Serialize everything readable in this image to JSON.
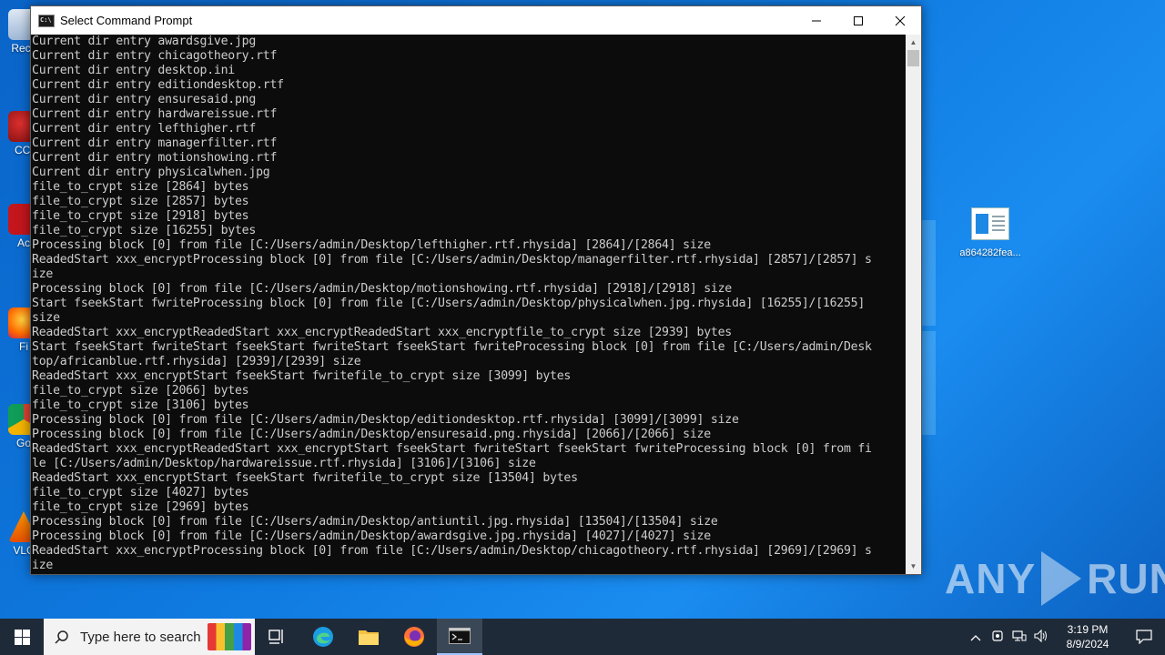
{
  "window": {
    "title": "Select Command Prompt",
    "app_icon": "C:\\",
    "minimize_icon": "minimize-icon",
    "maximize_icon": "maximize-icon",
    "close_icon": "close-icon"
  },
  "console_lines": [
    "Current dir entry awardsgive.jpg",
    "Current dir entry chicagotheory.rtf",
    "Current dir entry desktop.ini",
    "Current dir entry editiondesktop.rtf",
    "Current dir entry ensuresaid.png",
    "Current dir entry hardwareissue.rtf",
    "Current dir entry lefthigher.rtf",
    "Current dir entry managerfilter.rtf",
    "Current dir entry motionshowing.rtf",
    "Current dir entry physicalwhen.jpg",
    "file_to_crypt size [2864] bytes",
    "file_to_crypt size [2857] bytes",
    "file_to_crypt size [2918] bytes",
    "file_to_crypt size [16255] bytes",
    "Processing block [0] from file [C:/Users/admin/Desktop/lefthigher.rtf.rhysida] [2864]/[2864] size",
    "ReadedStart xxx_encryptProcessing block [0] from file [C:/Users/admin/Desktop/managerfilter.rtf.rhysida] [2857]/[2857] s",
    "ize",
    "Processing block [0] from file [C:/Users/admin/Desktop/motionshowing.rtf.rhysida] [2918]/[2918] size",
    "Start fseekStart fwriteProcessing block [0] from file [C:/Users/admin/Desktop/physicalwhen.jpg.rhysida] [16255]/[16255]",
    "size",
    "ReadedStart xxx_encryptReadedStart xxx_encryptReadedStart xxx_encryptfile_to_crypt size [2939] bytes",
    "Start fseekStart fwriteStart fseekStart fwriteStart fseekStart fwriteProcessing block [0] from file [C:/Users/admin/Desk",
    "top/africanblue.rtf.rhysida] [2939]/[2939] size",
    "ReadedStart xxx_encryptStart fseekStart fwritefile_to_crypt size [3099] bytes",
    "file_to_crypt size [2066] bytes",
    "file_to_crypt size [3106] bytes",
    "Processing block [0] from file [C:/Users/admin/Desktop/editiondesktop.rtf.rhysida] [3099]/[3099] size",
    "Processing block [0] from file [C:/Users/admin/Desktop/ensuresaid.png.rhysida] [2066]/[2066] size",
    "ReadedStart xxx_encryptReadedStart xxx_encryptStart fseekStart fwriteStart fseekStart fwriteProcessing block [0] from fi",
    "le [C:/Users/admin/Desktop/hardwareissue.rtf.rhysida] [3106]/[3106] size",
    "ReadedStart xxx_encryptStart fseekStart fwritefile_to_crypt size [13504] bytes",
    "file_to_crypt size [4027] bytes",
    "file_to_crypt size [2969] bytes",
    "Processing block [0] from file [C:/Users/admin/Desktop/antiuntil.jpg.rhysida] [13504]/[13504] size",
    "Processing block [0] from file [C:/Users/admin/Desktop/awardsgive.jpg.rhysida] [4027]/[4027] size",
    "ReadedStart xxx_encryptProcessing block [0] from file [C:/Users/admin/Desktop/chicagotheory.rtf.rhysida] [2969]/[2969] s",
    "ize"
  ],
  "desktop_icons": [
    {
      "label": "Recy",
      "icon": "recycle-bin-icon"
    },
    {
      "label": "CCl",
      "icon": "ccleaner-icon"
    },
    {
      "label": "Ac",
      "icon": "acrobat-icon"
    },
    {
      "label": "Fi",
      "icon": "firefox-icon"
    },
    {
      "label": "Go",
      "icon": "chrome-icon"
    },
    {
      "label": "VLC",
      "icon": "vlc-icon"
    }
  ],
  "desktop_file": {
    "label": "a864282fea..."
  },
  "watermark": {
    "text_left": "ANY",
    "text_right": "RUN"
  },
  "taskbar": {
    "search_placeholder": "Type here to search",
    "clock_time": "3:19 PM",
    "clock_date": "8/9/2024"
  },
  "colors": {
    "desktop": "#0f7ae0",
    "console_bg": "#0c0c0c",
    "console_text": "#cccccc",
    "taskbar": "#1f2a38"
  }
}
